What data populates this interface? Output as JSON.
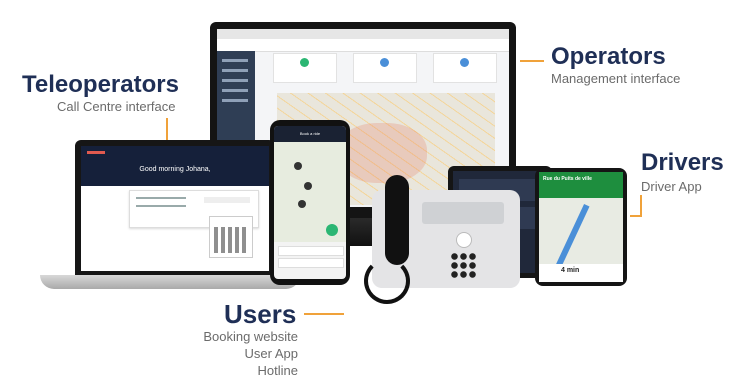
{
  "labels": {
    "operators": {
      "title": "Operators",
      "subtitle": "Management interface"
    },
    "teleoperators": {
      "title": "Teleoperators",
      "subtitle": "Call Centre interface"
    },
    "drivers": {
      "title": "Drivers",
      "subtitle": "Driver App"
    },
    "users": {
      "title": "Users",
      "lines": [
        "Booking website",
        "User App",
        "Hotline"
      ]
    }
  },
  "teleoperator_screen": {
    "greeting": "Good morning Johana,"
  },
  "phone_screen": {
    "header": "Book a ride"
  },
  "driver_nav": {
    "street": "Rue du Puits de ville",
    "eta": "4 min"
  },
  "colors": {
    "title": "#1f2f56",
    "subtitle": "#6b6b6b",
    "connector": "#f0a23a",
    "app_accent": "#2bb673",
    "sidebar": "#2f3e55",
    "nav_green": "#1e8e3e"
  },
  "icons": [
    "phone-handset-icon",
    "keypad-icon",
    "map-marker-icon"
  ]
}
